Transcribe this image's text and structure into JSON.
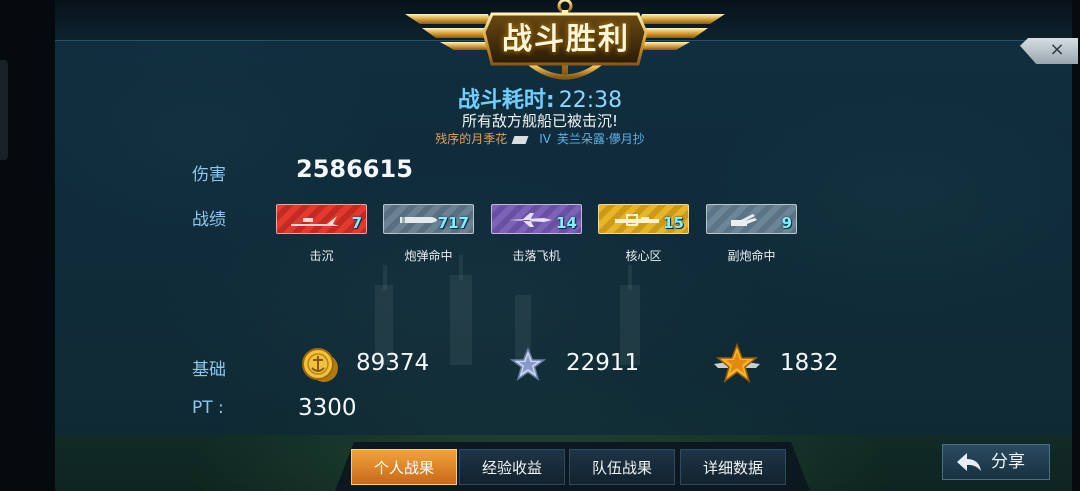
{
  "header": {
    "title": "战斗胜利",
    "close_icon": "×"
  },
  "battle": {
    "duration_label": "战斗耗时:",
    "duration_value": "22:38",
    "result_message": "所有敌方舰船已被击沉!",
    "player_name": "残序的月季花",
    "rank": "IV",
    "ship_name": "芙兰朵露·儚月抄"
  },
  "damage": {
    "label": "伤害",
    "value": "2586615"
  },
  "record": {
    "label": "战绩",
    "items": [
      {
        "caption": "击沉",
        "value": "7",
        "icon": "sinking-ship-icon",
        "color": "#e23a2e"
      },
      {
        "caption": "炮弹命中",
        "value": "717",
        "icon": "shell-icon",
        "color": "#6a8294"
      },
      {
        "caption": "击落飞机",
        "value": "14",
        "icon": "aircraft-icon",
        "color": "#7e62b8"
      },
      {
        "caption": "核心区",
        "value": "15",
        "icon": "citadel-icon",
        "color": "#e8b52a"
      },
      {
        "caption": "副炮命中",
        "value": "9",
        "icon": "secondary-gun-icon",
        "color": "#6c8698"
      }
    ]
  },
  "base": {
    "label": "基础",
    "coins": "89374",
    "silver_xp": "22911",
    "gold_xp": "1832"
  },
  "pt": {
    "label": "PT :",
    "value": "3300"
  },
  "tabs": [
    {
      "label": "个人战果",
      "active": true
    },
    {
      "label": "经验收益",
      "active": false
    },
    {
      "label": "队伍战果",
      "active": false
    },
    {
      "label": "详细数据",
      "active": false
    }
  ],
  "share": {
    "label": "分享"
  }
}
